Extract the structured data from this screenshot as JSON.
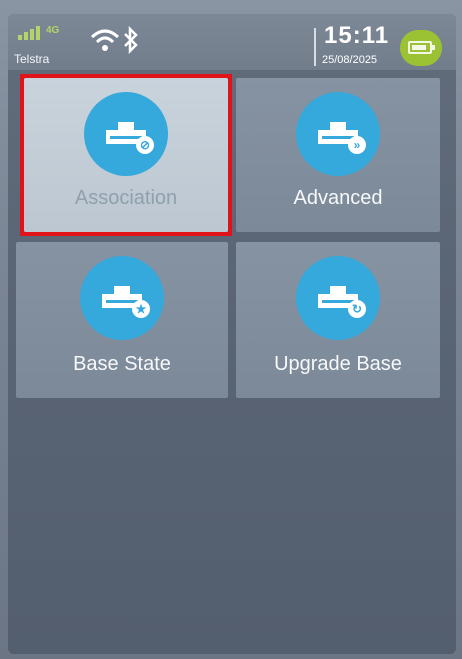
{
  "status_bar": {
    "network_type": "4G",
    "carrier": "Telstra",
    "time": "15:11",
    "date": "25/08/2025",
    "icons": [
      "signal-icon",
      "wifi-icon",
      "bluetooth-icon",
      "battery-icon"
    ]
  },
  "menu": {
    "tiles": [
      {
        "label": "Association",
        "icon": "dock-link-icon",
        "badge": "⊘",
        "selected": true
      },
      {
        "label": "Advanced",
        "icon": "dock-forward-icon",
        "badge": "»",
        "selected": false
      },
      {
        "label": "Base State",
        "icon": "dock-star-icon",
        "badge": "★",
        "selected": false
      },
      {
        "label": "Upgrade Base",
        "icon": "dock-refresh-icon",
        "badge": "↻",
        "selected": false
      }
    ]
  },
  "colors": {
    "icon_circle": "#35a8dc",
    "highlight_border": "#e0121a",
    "battery": "#9bc232"
  }
}
